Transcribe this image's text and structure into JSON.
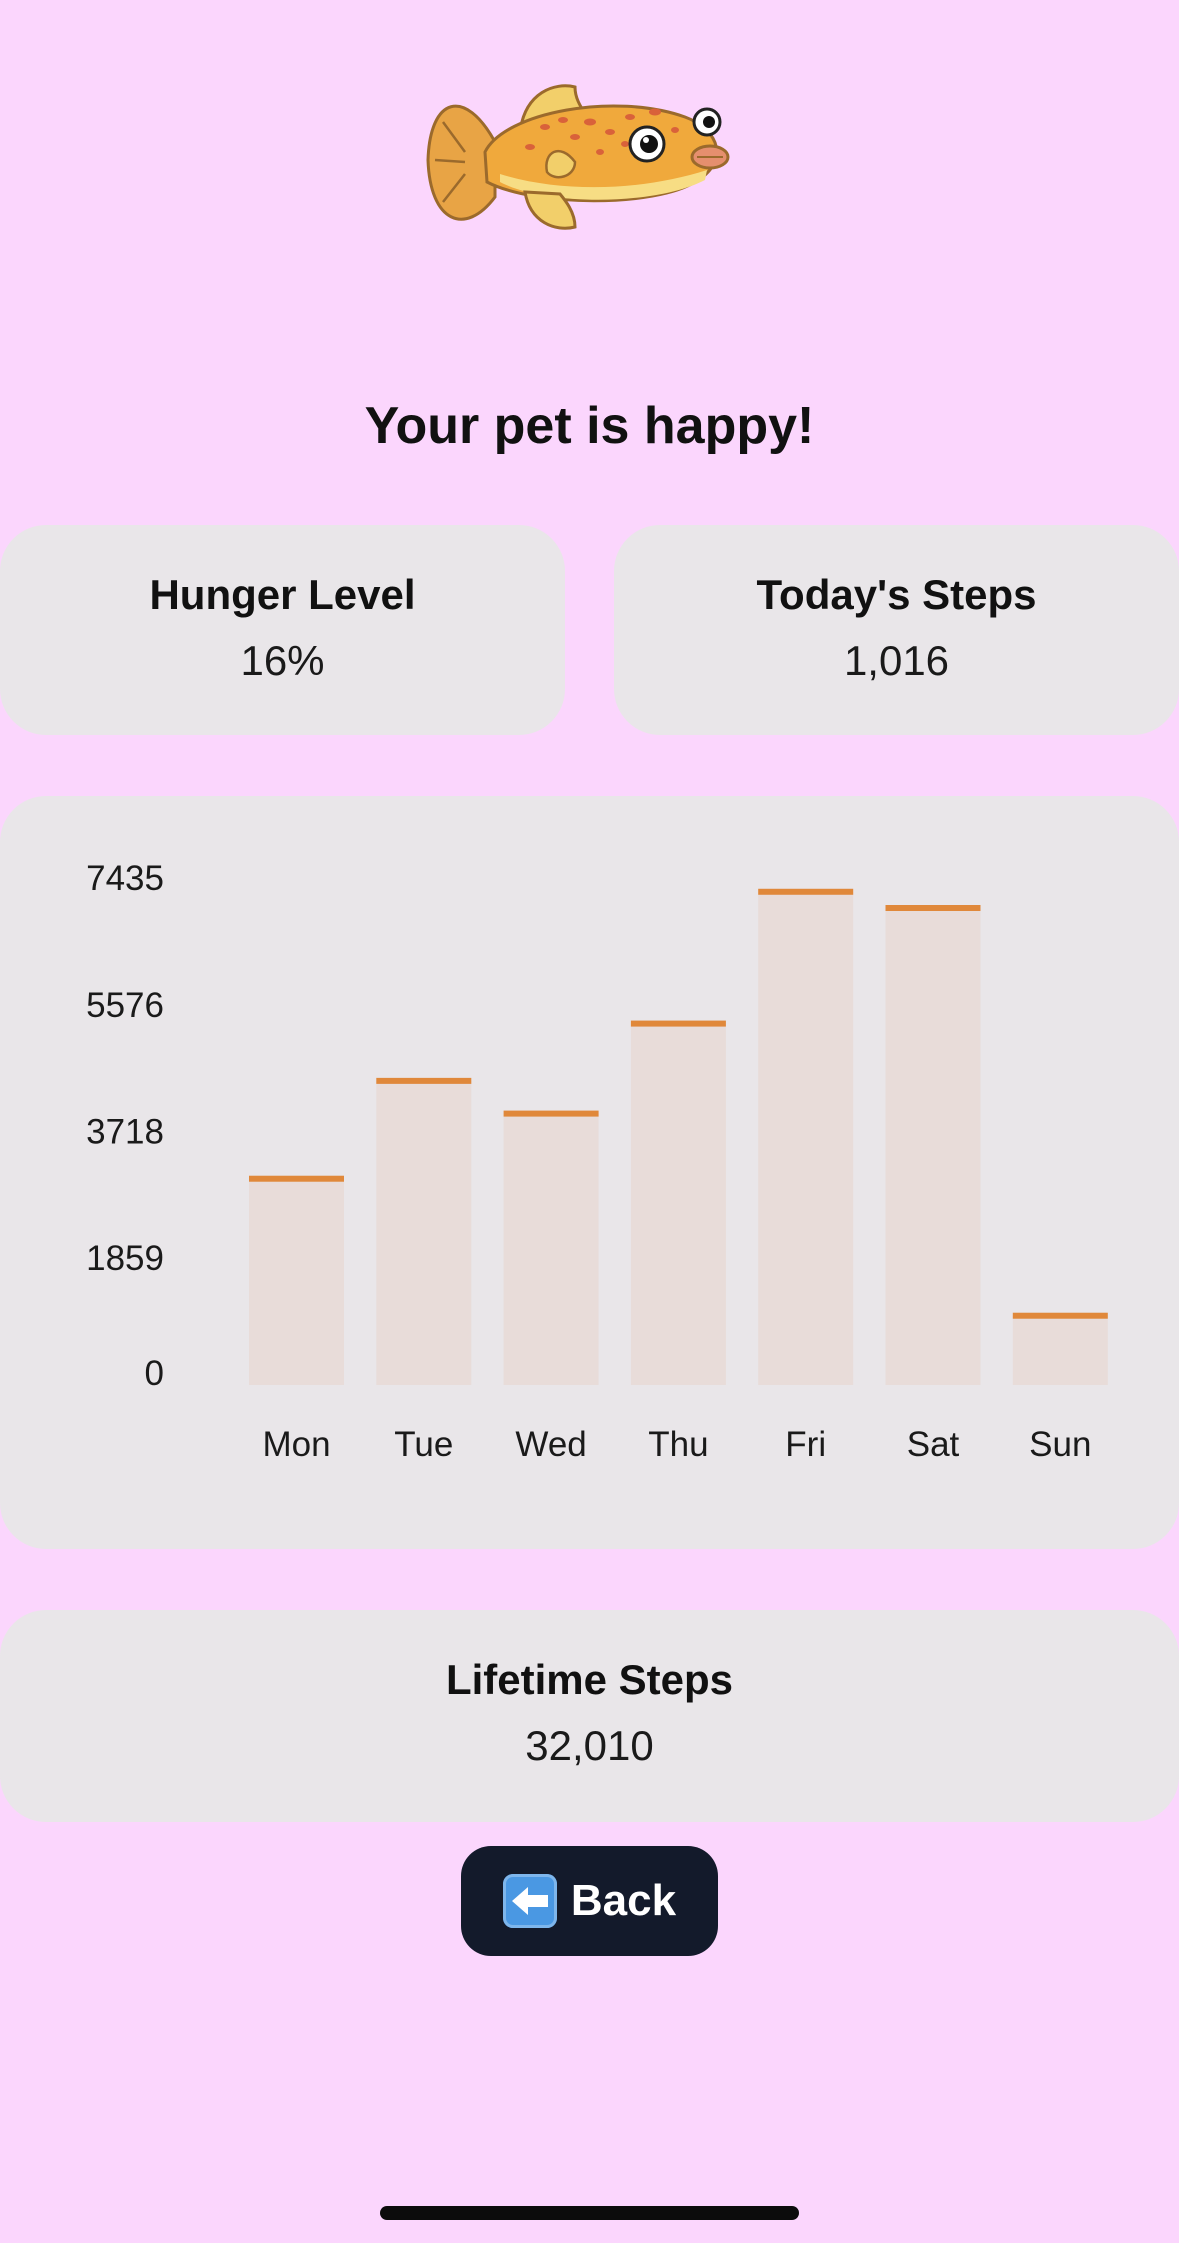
{
  "status_message": "Your pet is happy!",
  "stats": {
    "hunger": {
      "label": "Hunger Level",
      "value": "16%"
    },
    "today": {
      "label": "Today's Steps",
      "value": "1,016"
    },
    "lifetime": {
      "label": "Lifetime Steps",
      "value": "32,010"
    }
  },
  "back_button": {
    "label": "Back",
    "icon": "back-arrow-icon"
  },
  "pet": {
    "icon": "pufferfish-icon"
  },
  "colors": {
    "background": "#fbd6fd",
    "card": "#e9e6e9",
    "bar_fill": "#e8dcd9",
    "bar_top": "#e0883a",
    "button": "#131a2b"
  },
  "chart_data": {
    "type": "bar",
    "categories": [
      "Mon",
      "Tue",
      "Wed",
      "Thu",
      "Fri",
      "Sat",
      "Sun"
    ],
    "values": [
      3025,
      4460,
      3980,
      5300,
      7233,
      6995,
      1016
    ],
    "yticks": [
      0,
      1859,
      3718,
      5576,
      7435
    ],
    "ylim": [
      0,
      7435
    ],
    "title": "",
    "xlabel": "",
    "ylabel": "",
    "grid": false,
    "legend": "none"
  }
}
